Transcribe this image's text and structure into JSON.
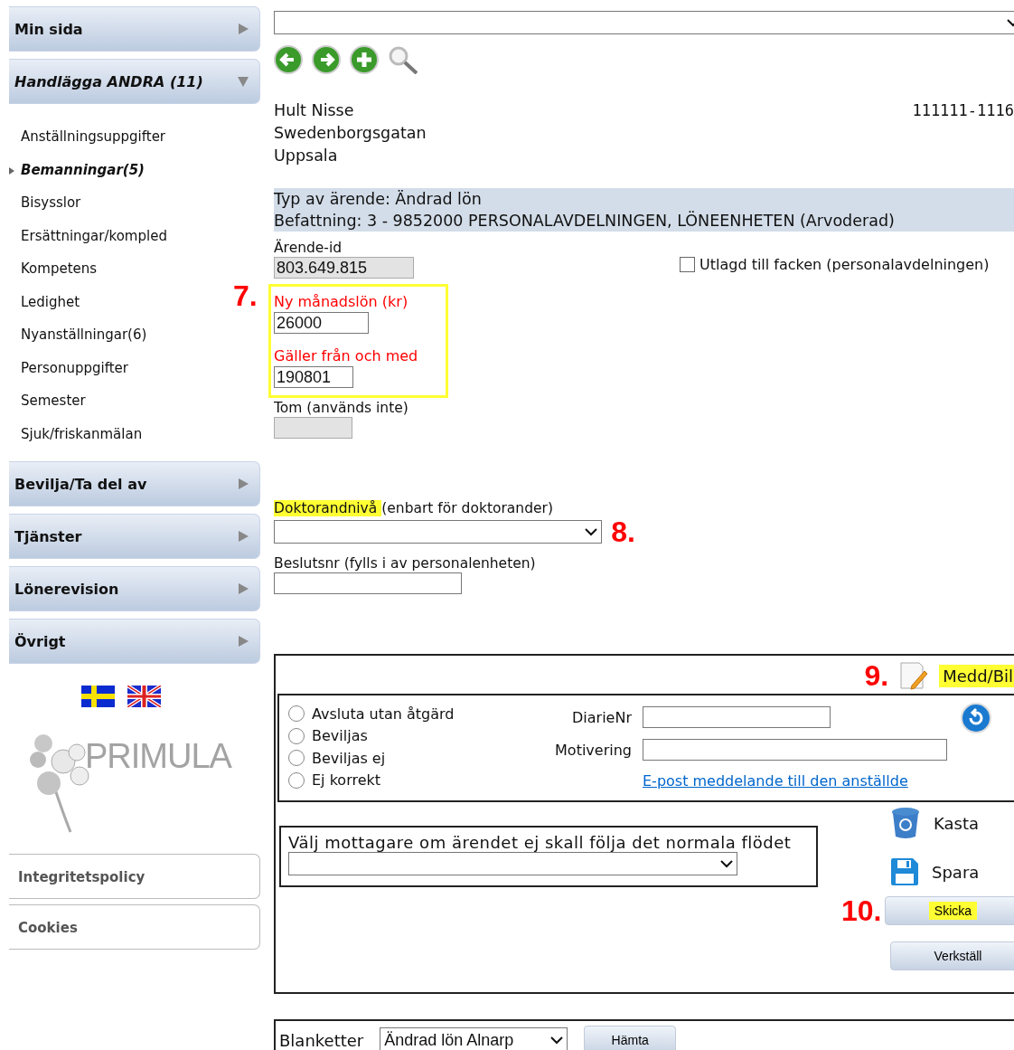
{
  "sidebar": {
    "menu": [
      {
        "label": "Min sida",
        "expanded": false
      },
      {
        "label": "Handlägga ANDRA (11)",
        "expanded": true,
        "children": [
          {
            "label": "Anställningsuppgifter",
            "selected": false
          },
          {
            "label": "Bemanningar(5)",
            "selected": true
          },
          {
            "label": "Bisysslor",
            "selected": false
          },
          {
            "label": "Ersättningar/kompled",
            "selected": false
          },
          {
            "label": "Kompetens",
            "selected": false
          },
          {
            "label": "Ledighet",
            "selected": false
          },
          {
            "label": "Nyanställningar(6)",
            "selected": false
          },
          {
            "label": "Personuppgifter",
            "selected": false
          },
          {
            "label": "Semester",
            "selected": false
          },
          {
            "label": "Sjuk/friskanmälan",
            "selected": false
          }
        ]
      },
      {
        "label": "Bevilja/Ta del av",
        "expanded": false
      },
      {
        "label": "Tjänster",
        "expanded": false
      },
      {
        "label": "Lönerevision",
        "expanded": false
      },
      {
        "label": "Övrigt",
        "expanded": false
      }
    ],
    "logo": {
      "text": "PRIMULA"
    },
    "footer_links": [
      "Integritetspolicy",
      "Cookies"
    ]
  },
  "main": {
    "person": {
      "name": "Hult Nisse",
      "street": "Swedenborgsgatan",
      "city": "Uppsala",
      "id": "111111-1116"
    },
    "case_header": [
      "Typ av ärende: Ändrad lön",
      "Befattning: 3 - 9852000 PERSONALAVDELNINGEN, LÖNEENHETEN (Arvoderad)"
    ],
    "case_id": {
      "label": "Ärende-id",
      "value": "803.649.815"
    },
    "union_checkbox": {
      "label": "Utlagd till facken (personalavdelningen)",
      "checked": false
    },
    "salary_group": {
      "marker": "7.",
      "fields": [
        {
          "label": "Ny månadslön (kr)",
          "value": "26000"
        },
        {
          "label": "Gäller från och med",
          "value": "190801"
        }
      ]
    },
    "tom_field": {
      "label": "Tom (används inte)",
      "disabled": true
    },
    "doctoral_level": {
      "label": "Doktorandnivå",
      "note": "(enbart för doktorander)",
      "highlighted": true,
      "marker": "8."
    },
    "decision_no": {
      "label": "Beslutsnr (fylls i av personalenheten)"
    },
    "decision_panel": {
      "marker": "9.",
      "attachments_link": {
        "label": "Medd/Bil",
        "highlighted": true
      },
      "options": [
        {
          "label": "Avsluta utan åtgärd",
          "selected": false
        },
        {
          "label": "Beviljas",
          "selected": false
        },
        {
          "label": "Beviljas ej",
          "selected": false
        },
        {
          "label": "Ej korrekt",
          "selected": false
        }
      ],
      "diarie_label": "DiarieNr",
      "motivation_label": "Motivering",
      "email_link": "E-post meddelande till den anställde",
      "recipient_label": "Välj mottagare om ärendet ej skall följa det normala flödet",
      "discard": "Kasta",
      "save": "Spara",
      "send": {
        "marker": "10.",
        "label": "Skicka",
        "highlighted": true
      },
      "execute": "Verkställ"
    },
    "forms": {
      "label": "Blanketter",
      "value": "Ändrad lön Alnarp",
      "button": "Hämta"
    }
  }
}
